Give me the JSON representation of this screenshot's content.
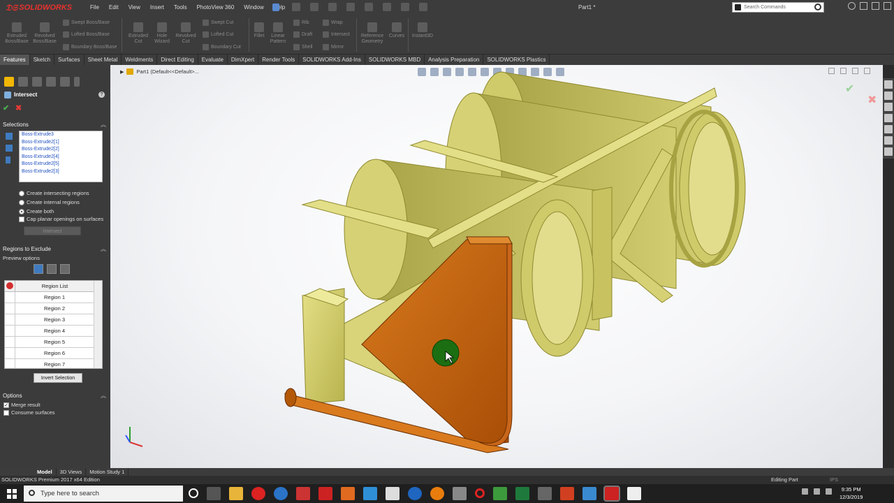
{
  "app": {
    "brand": "SOLIDWORKS",
    "document_title": "Part1 *",
    "search_placeholder": "Search Commands"
  },
  "menu": [
    "File",
    "Edit",
    "View",
    "Insert",
    "Tools",
    "PhotoView 360",
    "Window",
    "Help"
  ],
  "command_manager": {
    "extruded_boss": "Extruded\nBoss/Base",
    "revolved_boss": "Revolved\nBoss/Base",
    "swept_boss": "Swept Boss/Base",
    "lofted_boss": "Lofted Boss/Base",
    "boundary_boss": "Boundary Boss/Base",
    "extruded_cut": "Extruded\nCut",
    "hole_wizard": "Hole\nWizard",
    "revolved_cut": "Revolved\nCut",
    "swept_cut": "Swept Cut",
    "lofted_cut": "Lofted Cut",
    "boundary_cut": "Boundary Cut",
    "fillet": "Fillet",
    "linear_pattern": "Linear\nPattern",
    "rib": "Rib",
    "draft": "Draft",
    "shell": "Shell",
    "wrap": "Wrap",
    "intersect": "Intersect",
    "mirror": "Mirror",
    "reference_geometry": "Reference\nGeometry",
    "curves": "Curves",
    "instant3d": "Instant3D"
  },
  "tabs": [
    "Features",
    "Sketch",
    "Surfaces",
    "Sheet Metal",
    "Weldments",
    "Direct Editing",
    "Evaluate",
    "DimXpert",
    "Render Tools",
    "SOLIDWORKS Add-Ins",
    "SOLIDWORKS MBD",
    "Analysis Preparation",
    "SOLIDWORKS Plastics"
  ],
  "property_manager": {
    "title": "Intersect",
    "help": "?",
    "selections_header": "Selections",
    "selections": [
      "Boss-Extrude3",
      "Boss-Extrude2[1]",
      "Boss-Extrude2[2]",
      "Boss-Extrude2[4]",
      "Boss-Extrude2[5]",
      "Boss-Extrude2[3]"
    ],
    "radio_intersecting": "Create intersecting regions",
    "radio_internal": "Create internal regions",
    "radio_both": "Create both",
    "cap_planar": "Cap planar openings on surfaces",
    "intersect_button": "Intersect",
    "regions_header": "Regions to Exclude",
    "preview_options": "Preview options",
    "region_list_header": "Region List",
    "regions": [
      "Region   1",
      "Region   2",
      "Region   3",
      "Region   4",
      "Region   5",
      "Region   6",
      "Region   7"
    ],
    "invert_selection": "Invert Selection",
    "options_header": "Options",
    "merge_result": "Merge result",
    "consume_surfaces": "Consume surfaces"
  },
  "viewport": {
    "breadcrumb": "Part1  (Default<<Default>..."
  },
  "bottom_tabs": [
    "Model",
    "3D Views",
    "Motion Study 1"
  ],
  "status": {
    "left": "SOLIDWORKS Premium 2017 x64 Edition",
    "editing": "Editing Part",
    "units": "IPS"
  },
  "taskbar": {
    "search": "Type here to search",
    "time": "9:35 PM",
    "date": "12/3/2019"
  },
  "colors": {
    "model_yellow": "#d4cf6a",
    "model_orange": "#c8620a",
    "brand_red": "#e8322d"
  }
}
